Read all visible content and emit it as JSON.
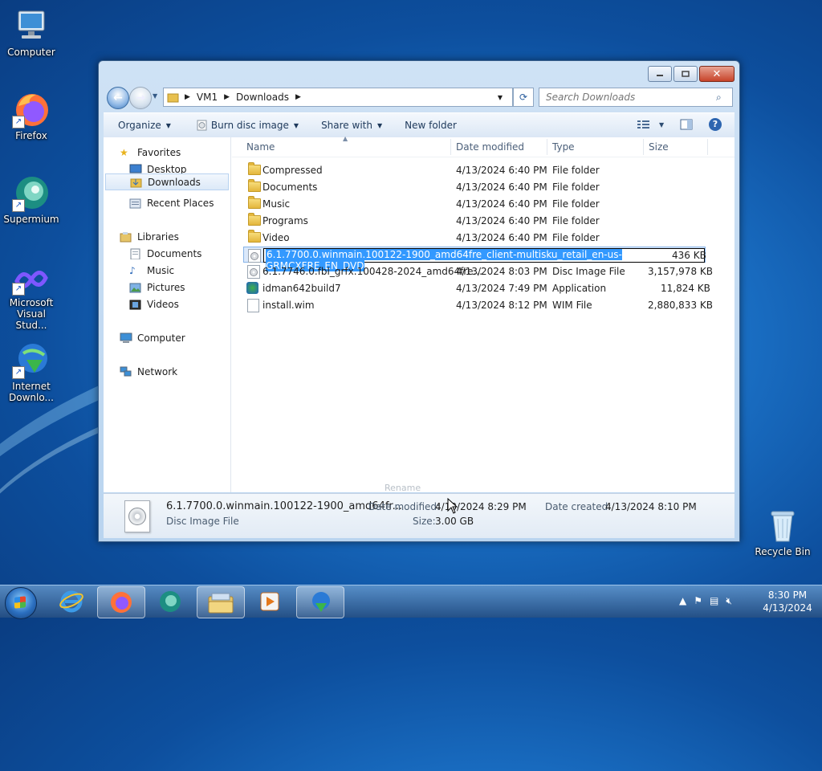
{
  "desktop": {
    "icons": [
      {
        "label": "Computer"
      },
      {
        "label": "Firefox"
      },
      {
        "label": "Supermium"
      },
      {
        "label": "Microsoft Visual Stud..."
      },
      {
        "label": "Internet Downlo..."
      },
      {
        "label": "Recycle Bin"
      }
    ]
  },
  "window": {
    "address": {
      "segments": [
        "VM1",
        "Downloads"
      ]
    },
    "search_placeholder": "Search Downloads",
    "toolbar": {
      "organize": "Organize",
      "burn": "Burn disc image",
      "share": "Share with",
      "new_folder": "New folder"
    },
    "nav": {
      "favorites": "Favorites",
      "desktop": "Desktop",
      "downloads": "Downloads",
      "recent": "Recent Places",
      "libraries": "Libraries",
      "documents": "Documents",
      "music": "Music",
      "pictures": "Pictures",
      "videos": "Videos",
      "computer": "Computer",
      "network": "Network"
    },
    "columns": {
      "name": "Name",
      "date": "Date modified",
      "type": "Type",
      "size": "Size"
    },
    "files": [
      {
        "name": "Compressed",
        "date": "4/13/2024 6:40 PM",
        "type": "File folder",
        "size": "",
        "icon": "folder"
      },
      {
        "name": "Documents",
        "date": "4/13/2024 6:40 PM",
        "type": "File folder",
        "size": "",
        "icon": "folder"
      },
      {
        "name": "Music",
        "date": "4/13/2024 6:40 PM",
        "type": "File folder",
        "size": "",
        "icon": "folder"
      },
      {
        "name": "Programs",
        "date": "4/13/2024 6:40 PM",
        "type": "File folder",
        "size": "",
        "icon": "folder"
      },
      {
        "name": "Video",
        "date": "4/13/2024 6:40 PM",
        "type": "File folder",
        "size": "",
        "icon": "folder"
      },
      {
        "name": "6.1.7700.0.winmain.100122-1900_amd64fre_client-multisku_retail_en-us-GRMCXFRE_EN_DVD",
        "date": "",
        "type": "",
        "size": "436 KB",
        "icon": "disc"
      },
      {
        "name": "6.1.7746.0.fbl_grfx.100428-2024_amd64fre...",
        "date": "4/13/2024 8:03 PM",
        "type": "Disc Image File",
        "size": "3,157,978 KB",
        "icon": "disc"
      },
      {
        "name": "idman642build7",
        "date": "4/13/2024 7:49 PM",
        "type": "Application",
        "size": "11,824 KB",
        "icon": "app"
      },
      {
        "name": "install.wim",
        "date": "4/13/2024 8:12 PM",
        "type": "WIM File",
        "size": "2,880,833 KB",
        "icon": "wim"
      }
    ],
    "rename_tooltip": "Rename",
    "details": {
      "name": "6.1.7700.0.winmain.100122-1900_amd64fr...",
      "type": "Disc Image File",
      "modified_label": "Date modified:",
      "modified_value": "4/13/2024 8:29 PM",
      "created_label": "Date created:",
      "created_value": "4/13/2024 8:10 PM",
      "size_label": "Size:",
      "size_value": "3.00 GB"
    }
  },
  "taskbar": {
    "time": "8:30 PM",
    "date": "4/13/2024"
  }
}
